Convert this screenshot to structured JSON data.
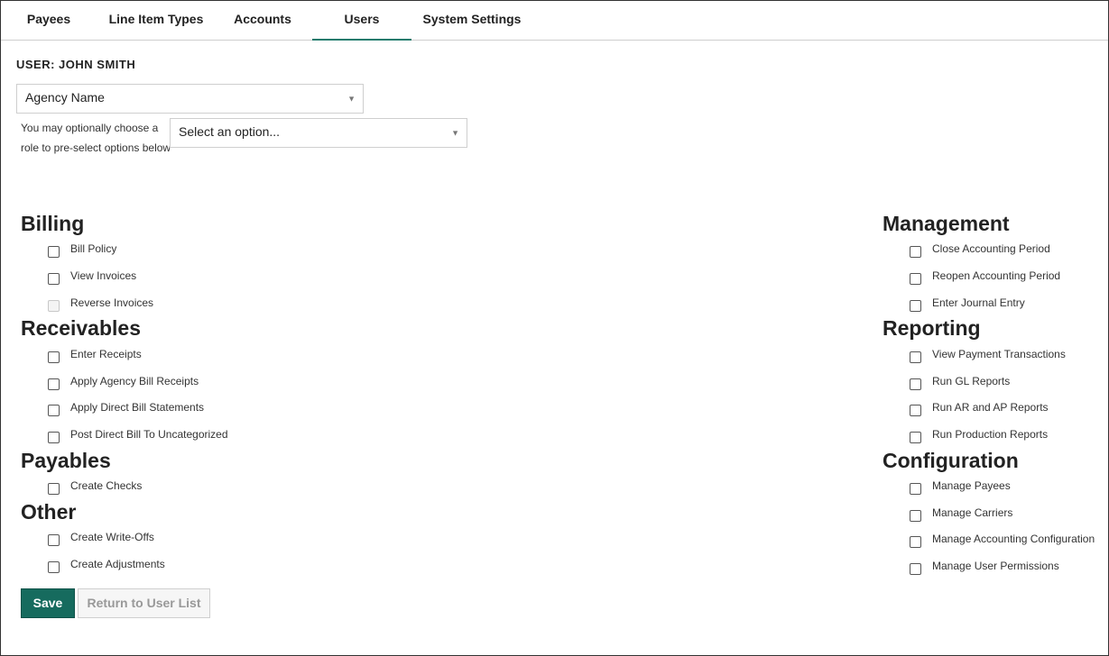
{
  "tabs": [
    {
      "label": "Payees"
    },
    {
      "label": "Line Item Types"
    },
    {
      "label": "Accounts"
    },
    {
      "label": "Users"
    },
    {
      "label": "System Settings"
    }
  ],
  "active_tab": "Users",
  "user_title": "USER: JOHN SMITH",
  "agency_select": {
    "value": "Agency Name"
  },
  "role_hint": "You may optionally choose a role to pre-select options below",
  "role_select": {
    "value": "Select an option..."
  },
  "sections": {
    "billing": {
      "title": "Billing",
      "items": [
        {
          "label": "Bill Policy",
          "disabled": false
        },
        {
          "label": "View Invoices",
          "disabled": false
        },
        {
          "label": "Reverse Invoices",
          "disabled": true
        }
      ]
    },
    "receivables": {
      "title": "Receivables",
      "items": [
        {
          "label": "Enter Receipts"
        },
        {
          "label": "Apply Agency Bill Receipts"
        },
        {
          "label": "Apply Direct Bill Statements"
        },
        {
          "label": "Post Direct Bill To Uncategorized"
        }
      ]
    },
    "payables": {
      "title": "Payables",
      "items": [
        {
          "label": "Create Checks"
        }
      ]
    },
    "other": {
      "title": "Other",
      "items": [
        {
          "label": "Create Write-Offs"
        },
        {
          "label": "Create Adjustments"
        }
      ]
    },
    "management": {
      "title": "Management",
      "items": [
        {
          "label": "Close Accounting Period"
        },
        {
          "label": "Reopen Accounting Period"
        },
        {
          "label": "Enter Journal Entry"
        }
      ]
    },
    "reporting": {
      "title": "Reporting",
      "items": [
        {
          "label": "View Payment Transactions"
        },
        {
          "label": "Run GL Reports"
        },
        {
          "label": "Run AR and AP Reports"
        },
        {
          "label": "Run Production Reports"
        }
      ]
    },
    "configuration": {
      "title": "Configuration",
      "items": [
        {
          "label": "Manage Payees"
        },
        {
          "label": "Manage Carriers"
        },
        {
          "label": "Manage Accounting Configuration"
        },
        {
          "label": "Manage User Permissions"
        }
      ]
    }
  },
  "buttons": {
    "save": "Save",
    "return": "Return to User List"
  },
  "colors": {
    "accent": "#1e7b6c",
    "save_button": "#166b5e"
  }
}
